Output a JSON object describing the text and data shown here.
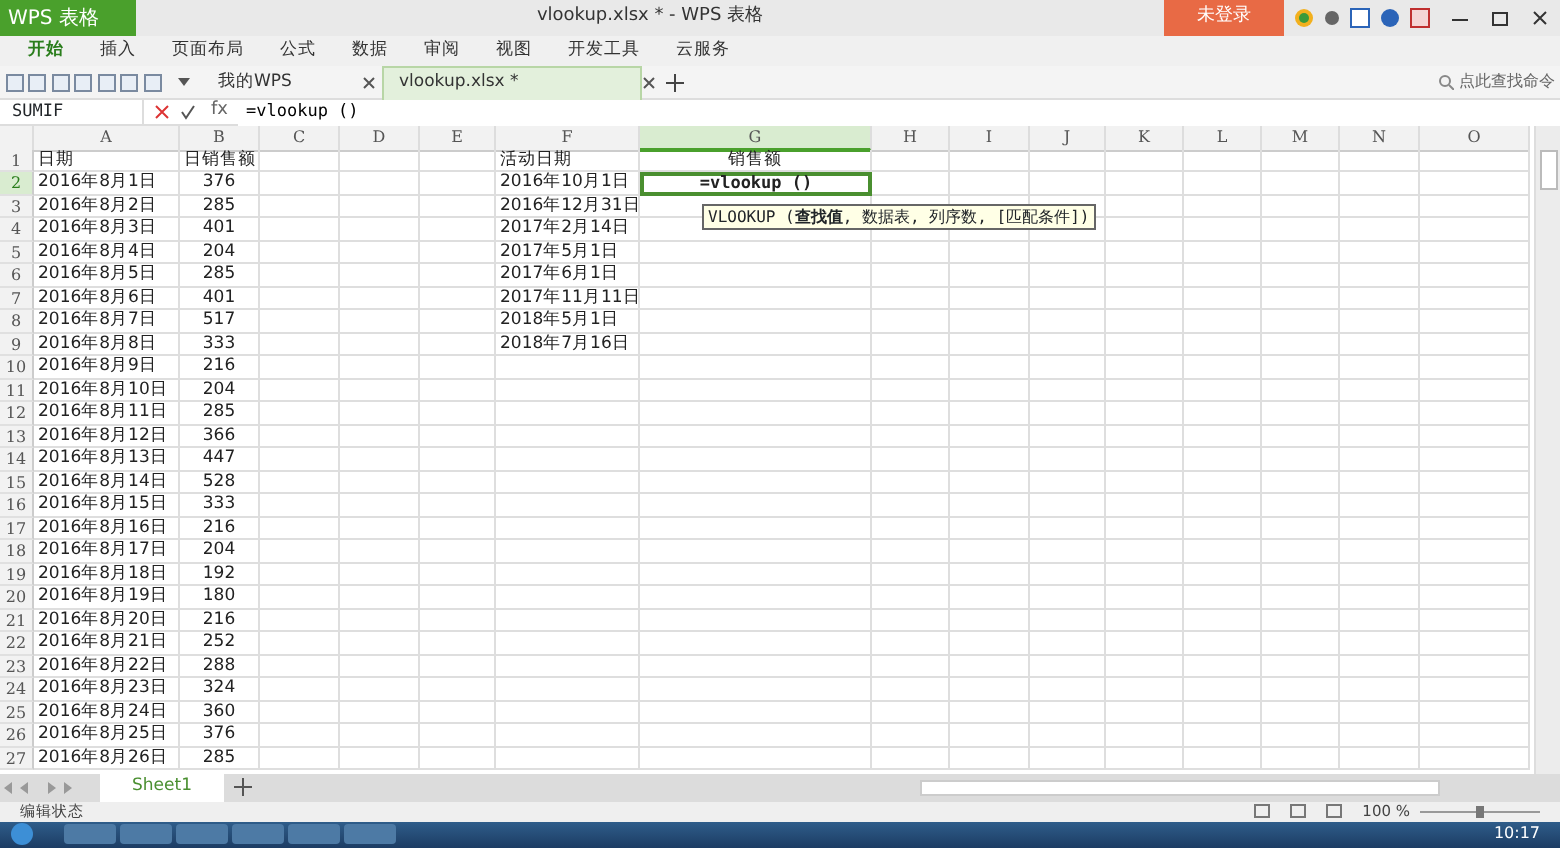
{
  "app_button": "WPS 表格",
  "window": {
    "title": "vlookup.xlsx * - WPS 表格",
    "login_button": "未登录"
  },
  "menu": [
    {
      "label": "开始",
      "selected": true
    },
    {
      "label": "插入",
      "selected": false
    },
    {
      "label": "页面布局",
      "selected": false
    },
    {
      "label": "公式",
      "selected": false
    },
    {
      "label": "数据",
      "selected": false
    },
    {
      "label": "审阅",
      "selected": false
    },
    {
      "label": "视图",
      "selected": false
    },
    {
      "label": "开发工具",
      "selected": false
    },
    {
      "label": "云服务",
      "selected": false
    }
  ],
  "doc_tabs": [
    {
      "label": "我的WPS",
      "selected": false
    },
    {
      "label": "vlookup.xlsx *",
      "selected": true
    }
  ],
  "search": {
    "placeholder": "点此查找命令"
  },
  "formula_bar": {
    "name_box": "SUMIF",
    "function_label": "fx",
    "formula": "=vlookup ()"
  },
  "columns": [
    {
      "label": "A",
      "selected": false
    },
    {
      "label": "B",
      "selected": false
    },
    {
      "label": "C",
      "selected": false
    },
    {
      "label": "D",
      "selected": false
    },
    {
      "label": "E",
      "selected": false
    },
    {
      "label": "F",
      "selected": false
    },
    {
      "label": "G",
      "selected": true
    },
    {
      "label": "H",
      "selected": false
    },
    {
      "label": "I",
      "selected": false
    },
    {
      "label": "J",
      "selected": false
    },
    {
      "label": "K",
      "selected": false
    },
    {
      "label": "L",
      "selected": false
    },
    {
      "label": "M",
      "selected": false
    },
    {
      "label": "N",
      "selected": false
    },
    {
      "label": "O",
      "selected": false
    }
  ],
  "rows": [
    {
      "number": "1",
      "selected": false,
      "editing": false,
      "a": "日期",
      "b": "日销售额",
      "f": "活动日期",
      "g": "销售额"
    },
    {
      "number": "2",
      "selected": true,
      "editing": true,
      "a": "2016年8月1日",
      "b": "376",
      "f": "2016年10月1日",
      "g": "=vlookup ()"
    },
    {
      "number": "3",
      "selected": false,
      "editing": false,
      "a": "2016年8月2日",
      "b": "285",
      "f": "2016年12月31日"
    },
    {
      "number": "4",
      "selected": false,
      "editing": false,
      "a": "2016年8月3日",
      "b": "401",
      "f": "2017年2月14日"
    },
    {
      "number": "5",
      "selected": false,
      "editing": false,
      "a": "2016年8月4日",
      "b": "204",
      "f": "2017年5月1日"
    },
    {
      "number": "6",
      "selected": false,
      "editing": false,
      "a": "2016年8月5日",
      "b": "285",
      "f": "2017年6月1日"
    },
    {
      "number": "7",
      "selected": false,
      "editing": false,
      "a": "2016年8月6日",
      "b": "401",
      "f": "2017年11月11日"
    },
    {
      "number": "8",
      "selected": false,
      "editing": false,
      "a": "2016年8月7日",
      "b": "517",
      "f": "2018年5月1日"
    },
    {
      "number": "9",
      "selected": false,
      "editing": false,
      "a": "2016年8月8日",
      "b": "333",
      "f": "2018年7月16日"
    },
    {
      "number": "10",
      "selected": false,
      "editing": false,
      "a": "2016年8月9日",
      "b": "216"
    },
    {
      "number": "11",
      "selected": false,
      "editing": false,
      "a": "2016年8月10日",
      "b": "204"
    },
    {
      "number": "12",
      "selected": false,
      "editing": false,
      "a": "2016年8月11日",
      "b": "285"
    },
    {
      "number": "13",
      "selected": false,
      "editing": false,
      "a": "2016年8月12日",
      "b": "366"
    },
    {
      "number": "14",
      "selected": false,
      "editing": false,
      "a": "2016年8月13日",
      "b": "447"
    },
    {
      "number": "15",
      "selected": false,
      "editing": false,
      "a": "2016年8月14日",
      "b": "528"
    },
    {
      "number": "16",
      "selected": false,
      "editing": false,
      "a": "2016年8月15日",
      "b": "333"
    },
    {
      "number": "17",
      "selected": false,
      "editing": false,
      "a": "2016年8月16日",
      "b": "216"
    },
    {
      "number": "18",
      "selected": false,
      "editing": false,
      "a": "2016年8月17日",
      "b": "204"
    },
    {
      "number": "19",
      "selected": false,
      "editing": false,
      "a": "2016年8月18日",
      "b": "192"
    },
    {
      "number": "20",
      "selected": false,
      "editing": false,
      "a": "2016年8月19日",
      "b": "180"
    },
    {
      "number": "21",
      "selected": false,
      "editing": false,
      "a": "2016年8月20日",
      "b": "216"
    },
    {
      "number": "22",
      "selected": false,
      "editing": false,
      "a": "2016年8月21日",
      "b": "252"
    },
    {
      "number": "23",
      "selected": false,
      "editing": false,
      "a": "2016年8月22日",
      "b": "288"
    },
    {
      "number": "24",
      "selected": false,
      "editing": false,
      "a": "2016年8月23日",
      "b": "324"
    },
    {
      "number": "25",
      "selected": false,
      "editing": false,
      "a": "2016年8月24日",
      "b": "360"
    },
    {
      "number": "26",
      "selected": false,
      "editing": false,
      "a": "2016年8月25日",
      "b": "376"
    },
    {
      "number": "27",
      "selected": false,
      "editing": false,
      "a": "2016年8月26日",
      "b": "285"
    }
  ],
  "tooltip": "VLOOKUP (**查找值**, 数据表, 列序数, [匹配条件])",
  "sheet_tabs": [
    {
      "label": "Sheet1",
      "selected": true
    }
  ],
  "status_bar": {
    "mode": "编辑状态",
    "zoom": "100 %"
  },
  "taskbar": {
    "time": "10:17"
  }
}
